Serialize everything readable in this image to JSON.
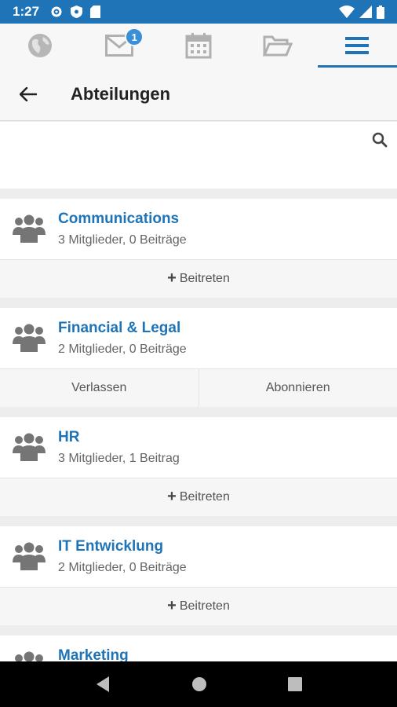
{
  "status_bar": {
    "time": "1:27"
  },
  "tabs": [
    {
      "name": "globe-icon"
    },
    {
      "name": "mail-icon",
      "badge": "1"
    },
    {
      "name": "calendar-icon"
    },
    {
      "name": "folder-icon"
    },
    {
      "name": "menu-icon",
      "active": true
    }
  ],
  "header": {
    "title": "Abteilungen"
  },
  "search": {
    "placeholder": ""
  },
  "departments": [
    {
      "name": "Communications",
      "meta": "3 Mitglieder, 0 Beiträge",
      "actions": [
        "Beitreten"
      ]
    },
    {
      "name": "Financial & Legal",
      "meta": "2 Mitglieder, 0 Beiträge",
      "actions": [
        "Verlassen",
        "Abonnieren"
      ]
    },
    {
      "name": "HR",
      "meta": "3 Mitglieder, 1 Beitrag",
      "actions": [
        "Beitreten"
      ]
    },
    {
      "name": "IT Entwicklung",
      "meta": "2 Mitglieder, 0 Beiträge",
      "actions": [
        "Beitreten"
      ]
    },
    {
      "name": "Marketing",
      "meta": "",
      "actions": []
    }
  ],
  "colors": {
    "accent": "#1f73b7",
    "background": "#ededed"
  }
}
